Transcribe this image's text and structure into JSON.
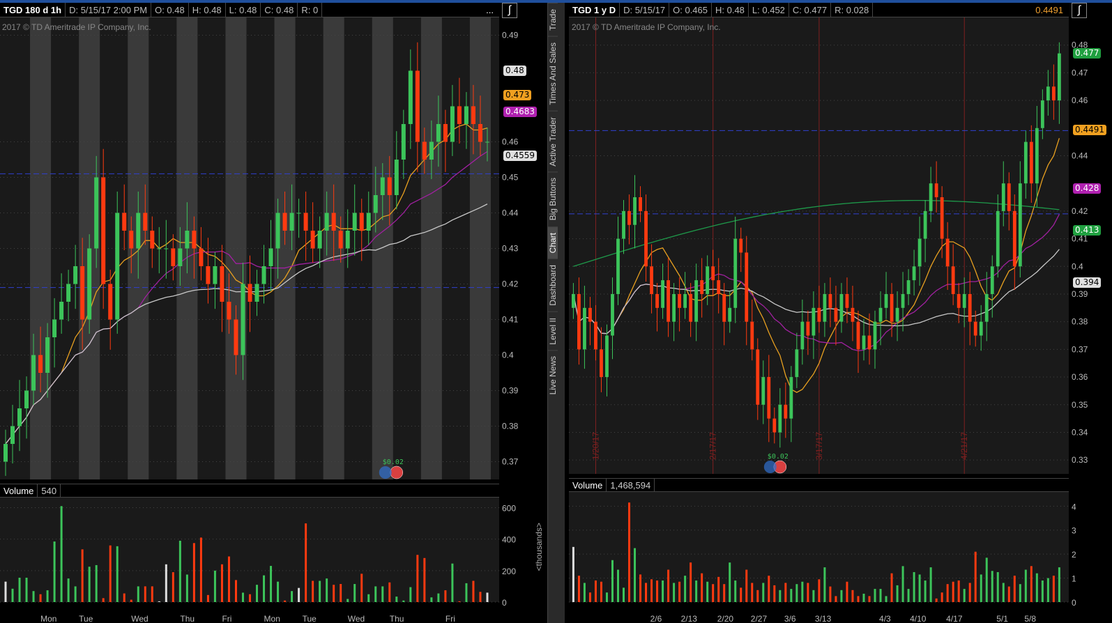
{
  "colors": {
    "up": "#3cc45a",
    "down": "#ff3a10",
    "sma9": "#e8a020",
    "sma20": "#a020a0",
    "sma50": "#c8c8c8",
    "sma200": "#1e9a4a",
    "hline": "#3040d0"
  },
  "tabs": [
    "Trade",
    "Times And Sales",
    "Active Trader",
    "Big Buttons",
    "Chart",
    "Dashboard",
    "Level II",
    "Live News"
  ],
  "active_tab": "Chart",
  "volume_unit": "<thousands>",
  "left": {
    "symbol": "TGD 180 d 1h",
    "date": "D: 5/15/17 2:00 PM",
    "open": "O: 0.48",
    "high": "H: 0.48",
    "low": "L: 0.48",
    "close": "C: 0.48",
    "range": "R: 0",
    "more": "...",
    "copyright": "2017 © TD Ameritrade IP Company, Inc.",
    "volume_label": "Volume",
    "volume_value": "540",
    "price_ticks": [
      "0.49",
      "0.46",
      "0.45",
      "0.44",
      "0.43",
      "0.42",
      "0.41",
      "0.4",
      "0.39",
      "0.38",
      "0.37"
    ],
    "price_min": 0.365,
    "price_max": 0.495,
    "hlines": [
      0.451,
      0.419
    ],
    "badges": [
      {
        "text": "0.48",
        "v": 0.48,
        "bg": "#e0e0e0",
        "fg": "#000"
      },
      {
        "text": "0.473",
        "v": 0.473,
        "bg": "#f0a020",
        "fg": "#000"
      },
      {
        "text": "0.4683",
        "v": 0.4683,
        "bg": "#b020b0",
        "fg": "#fff"
      },
      {
        "text": "0.4559",
        "v": 0.4559,
        "bg": "#e0e0e0",
        "fg": "#000"
      }
    ],
    "dividend": "$0.02",
    "vol_ticks": [
      "600",
      "400",
      "200",
      "0"
    ],
    "vol_max": 620,
    "days": [
      {
        "label": "Mon",
        "i": 6
      },
      {
        "label": "Tue",
        "i": 11.5
      },
      {
        "label": "Wed",
        "i": 19
      },
      {
        "label": "Thu",
        "i": 26
      },
      {
        "label": "Fri",
        "i": 32
      },
      {
        "label": "Mon",
        "i": 38
      },
      {
        "label": "Tue",
        "i": 43.5
      },
      {
        "label": "Wed",
        "i": 50
      },
      {
        "label": "Thu",
        "i": 56
      },
      {
        "label": "Fri",
        "i": 64
      }
    ],
    "closes": [
      0.375,
      0.38,
      0.385,
      0.39,
      0.4,
      0.395,
      0.405,
      0.41,
      0.415,
      0.42,
      0.425,
      0.41,
      0.43,
      0.45,
      0.42,
      0.41,
      0.44,
      0.435,
      0.43,
      0.44,
      0.435,
      0.43,
      0.43,
      0.43,
      0.425,
      0.43,
      0.435,
      0.43,
      0.425,
      0.42,
      0.425,
      0.415,
      0.41,
      0.4,
      0.42,
      0.415,
      0.42,
      0.425,
      0.43,
      0.44,
      0.435,
      0.44,
      0.44,
      0.435,
      0.43,
      0.435,
      0.44,
      0.435,
      0.43,
      0.435,
      0.44,
      0.435,
      0.44,
      0.445,
      0.45,
      0.445,
      0.455,
      0.465,
      0.48,
      0.46,
      0.455,
      0.46,
      0.465,
      0.46,
      0.47,
      0.465,
      0.47,
      0.465,
      0.46,
      0.46
    ],
    "volumes": [
      130,
      85,
      155,
      155,
      70,
      50,
      75,
      385,
      610,
      150,
      100,
      335,
      225,
      235,
      25,
      360,
      355,
      55,
      15,
      100,
      100,
      100,
      5,
      240,
      190,
      390,
      175,
      375,
      410,
      45,
      200,
      240,
      290,
      140,
      60,
      50,
      110,
      170,
      230,
      130,
      10,
      70,
      90,
      500,
      135,
      135,
      150,
      110,
      115,
      20,
      115,
      180,
      50,
      100,
      100,
      125,
      35,
      10,
      95,
      300,
      280,
      30,
      55,
      75,
      245,
      5,
      120,
      135,
      65,
      60
    ]
  },
  "right": {
    "symbol": "TGD 1 y D",
    "date": "D: 5/15/17",
    "open": "O: 0.465",
    "high": "H: 0.48",
    "low": "L: 0.452",
    "close": "C: 0.477",
    "range": "R: 0.028",
    "last": "0.4491",
    "copyright": "2017 © TD Ameritrade IP Company, Inc.",
    "volume_label": "Volume",
    "volume_value": "1,468,594",
    "price_ticks": [
      "0.48",
      "0.47",
      "0.46",
      "0.44",
      "0.42",
      "0.41",
      "0.4",
      "0.39",
      "0.38",
      "0.37",
      "0.36",
      "0.35",
      "0.34",
      "0.33"
    ],
    "price_min": 0.325,
    "price_max": 0.49,
    "hlines": [
      0.4491,
      0.419
    ],
    "badges": [
      {
        "text": "0.477",
        "v": 0.477,
        "bg": "#20a040",
        "fg": "#fff"
      },
      {
        "text": "0.4491",
        "v": 0.4491,
        "bg": "#f0a020",
        "fg": "#000"
      },
      {
        "text": "0.428",
        "v": 0.428,
        "bg": "#b020b0",
        "fg": "#fff"
      },
      {
        "text": "0.413",
        "v": 0.413,
        "bg": "#20a040",
        "fg": "#fff"
      },
      {
        "text": "0.394",
        "v": 0.394,
        "bg": "#e0e0e0",
        "fg": "#000"
      }
    ],
    "event_lines": [
      {
        "label": "1/20/17",
        "i": 4
      },
      {
        "label": "2/17/17",
        "i": 25
      },
      {
        "label": "3/17/17",
        "i": 44
      },
      {
        "label": "4/21/17",
        "i": 70
      }
    ],
    "dividend": "$0.02",
    "vol_ticks": [
      "4",
      "3",
      "2",
      "1",
      "0"
    ],
    "vol_max": 4.3,
    "dates": [
      {
        "label": "2/6",
        "i": 15
      },
      {
        "label": "2/13",
        "i": 20.5
      },
      {
        "label": "2/20",
        "i": 27
      },
      {
        "label": "2/27",
        "i": 33
      },
      {
        "label": "3/6",
        "i": 39
      },
      {
        "label": "3/13",
        "i": 44.5
      },
      {
        "label": "4/3",
        "i": 56
      },
      {
        "label": "4/10",
        "i": 61.5
      },
      {
        "label": "4/17",
        "i": 68
      },
      {
        "label": "5/1",
        "i": 77
      },
      {
        "label": "5/8",
        "i": 82
      }
    ],
    "closes": [
      0.39,
      0.37,
      0.385,
      0.38,
      0.37,
      0.36,
      0.375,
      0.39,
      0.41,
      0.42,
      0.415,
      0.425,
      0.42,
      0.4,
      0.39,
      0.385,
      0.395,
      0.38,
      0.39,
      0.385,
      0.39,
      0.38,
      0.395,
      0.39,
      0.4,
      0.395,
      0.39,
      0.38,
      0.385,
      0.41,
      0.405,
      0.38,
      0.37,
      0.35,
      0.36,
      0.345,
      0.34,
      0.35,
      0.345,
      0.36,
      0.37,
      0.38,
      0.375,
      0.385,
      0.38,
      0.39,
      0.385,
      0.38,
      0.39,
      0.385,
      0.38,
      0.37,
      0.375,
      0.37,
      0.38,
      0.385,
      0.39,
      0.38,
      0.385,
      0.39,
      0.395,
      0.4,
      0.41,
      0.42,
      0.43,
      0.425,
      0.41,
      0.4,
      0.39,
      0.385,
      0.39,
      0.38,
      0.375,
      0.38,
      0.39,
      0.4,
      0.42,
      0.43,
      0.42,
      0.4,
      0.43,
      0.445,
      0.43,
      0.45,
      0.46,
      0.465,
      0.46,
      0.477
    ],
    "volumes": [
      2.3,
      1.1,
      0.8,
      0.4,
      0.9,
      0.85,
      0.4,
      1.75,
      1.35,
      0.6,
      4.15,
      2.25,
      1.15,
      0.8,
      0.95,
      0.9,
      0.9,
      1.35,
      0.8,
      0.85,
      1.1,
      1.65,
      0.9,
      1.2,
      0.85,
      0.75,
      1.05,
      0.75,
      1.65,
      0.9,
      0.6,
      1.35,
      0.8,
      0.5,
      0.8,
      1.1,
      0.7,
      0.5,
      0.8,
      0.55,
      0.75,
      0.85,
      0.8,
      0.5,
      0.95,
      1.45,
      0.65,
      0.25,
      0.5,
      0.85,
      0.5,
      0.25,
      0.35,
      0.25,
      0.55,
      0.55,
      0.25,
      1.2,
      0.7,
      1.5,
      0.55,
      1.25,
      1.15,
      0.9,
      1.45,
      0.15,
      0.4,
      0.75,
      0.85,
      0.9,
      0.55,
      0.8,
      2.1,
      1.15,
      1.85,
      1.3,
      1.25,
      0.8,
      0.65,
      1.1,
      0.75,
      1.35,
      1.5,
      1.2,
      0.9,
      1.0,
      1.1,
      1.45
    ]
  }
}
